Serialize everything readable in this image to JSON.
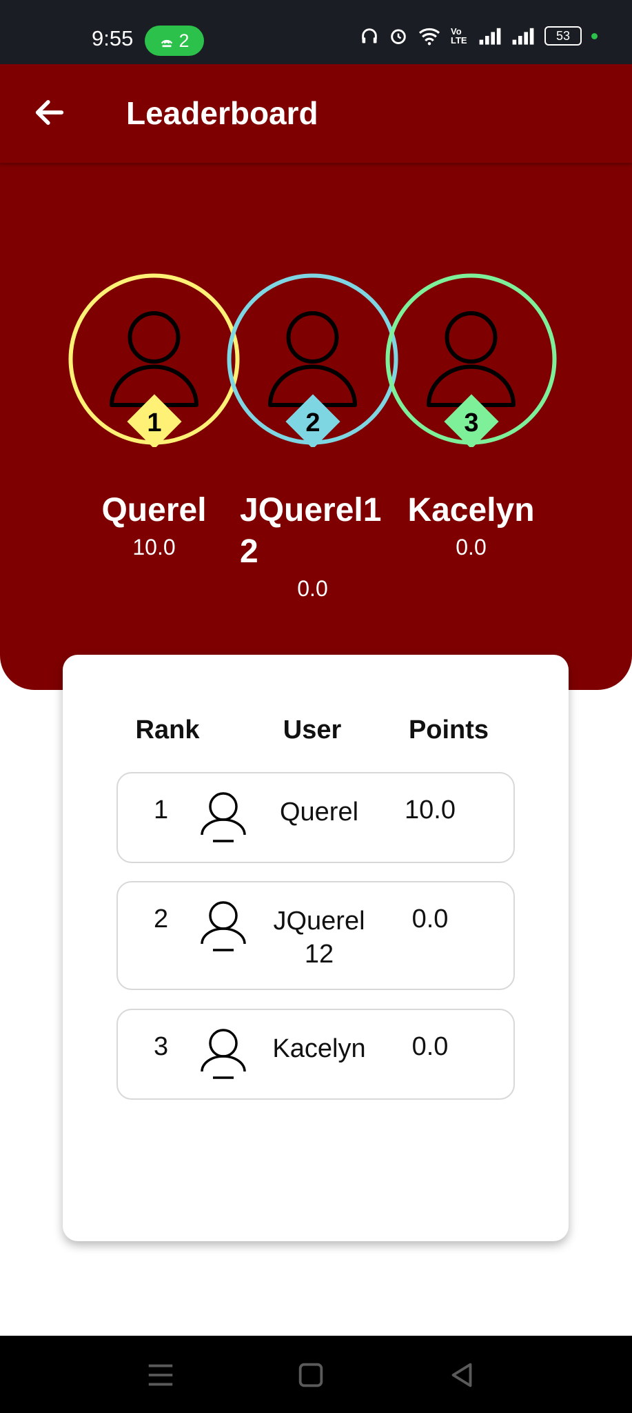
{
  "status_bar": {
    "time": "9:55",
    "hotspot_count": "2",
    "network_label": "Vo LTE",
    "battery": "53"
  },
  "header": {
    "title": "Leaderboard"
  },
  "podium": [
    {
      "rank": "1",
      "name": "Querel",
      "points": "10.0",
      "color": "#fff176"
    },
    {
      "rank": "2",
      "name": "JQuerel12",
      "points": "0.0",
      "color": "#7fd6e3"
    },
    {
      "rank": "3",
      "name": "Kacelyn",
      "points": "0.0",
      "color": "#7ef09a"
    }
  ],
  "table": {
    "headers": {
      "rank": "Rank",
      "user": "User",
      "points": "Points"
    },
    "rows": [
      {
        "rank": "1",
        "user": "Querel",
        "points": "10.0"
      },
      {
        "rank": "2",
        "user": "JQuerel12",
        "points": "0.0"
      },
      {
        "rank": "3",
        "user": "Kacelyn",
        "points": "0.0"
      }
    ]
  },
  "colors": {
    "primary": "#7e0000",
    "statusbar": "#1a1e24",
    "navbar": "#000000"
  },
  "icons": {
    "back": "arrow-left-icon",
    "avatar": "user-icon",
    "nav": [
      "menu-icon",
      "home-square-icon",
      "back-triangle-icon"
    ]
  }
}
